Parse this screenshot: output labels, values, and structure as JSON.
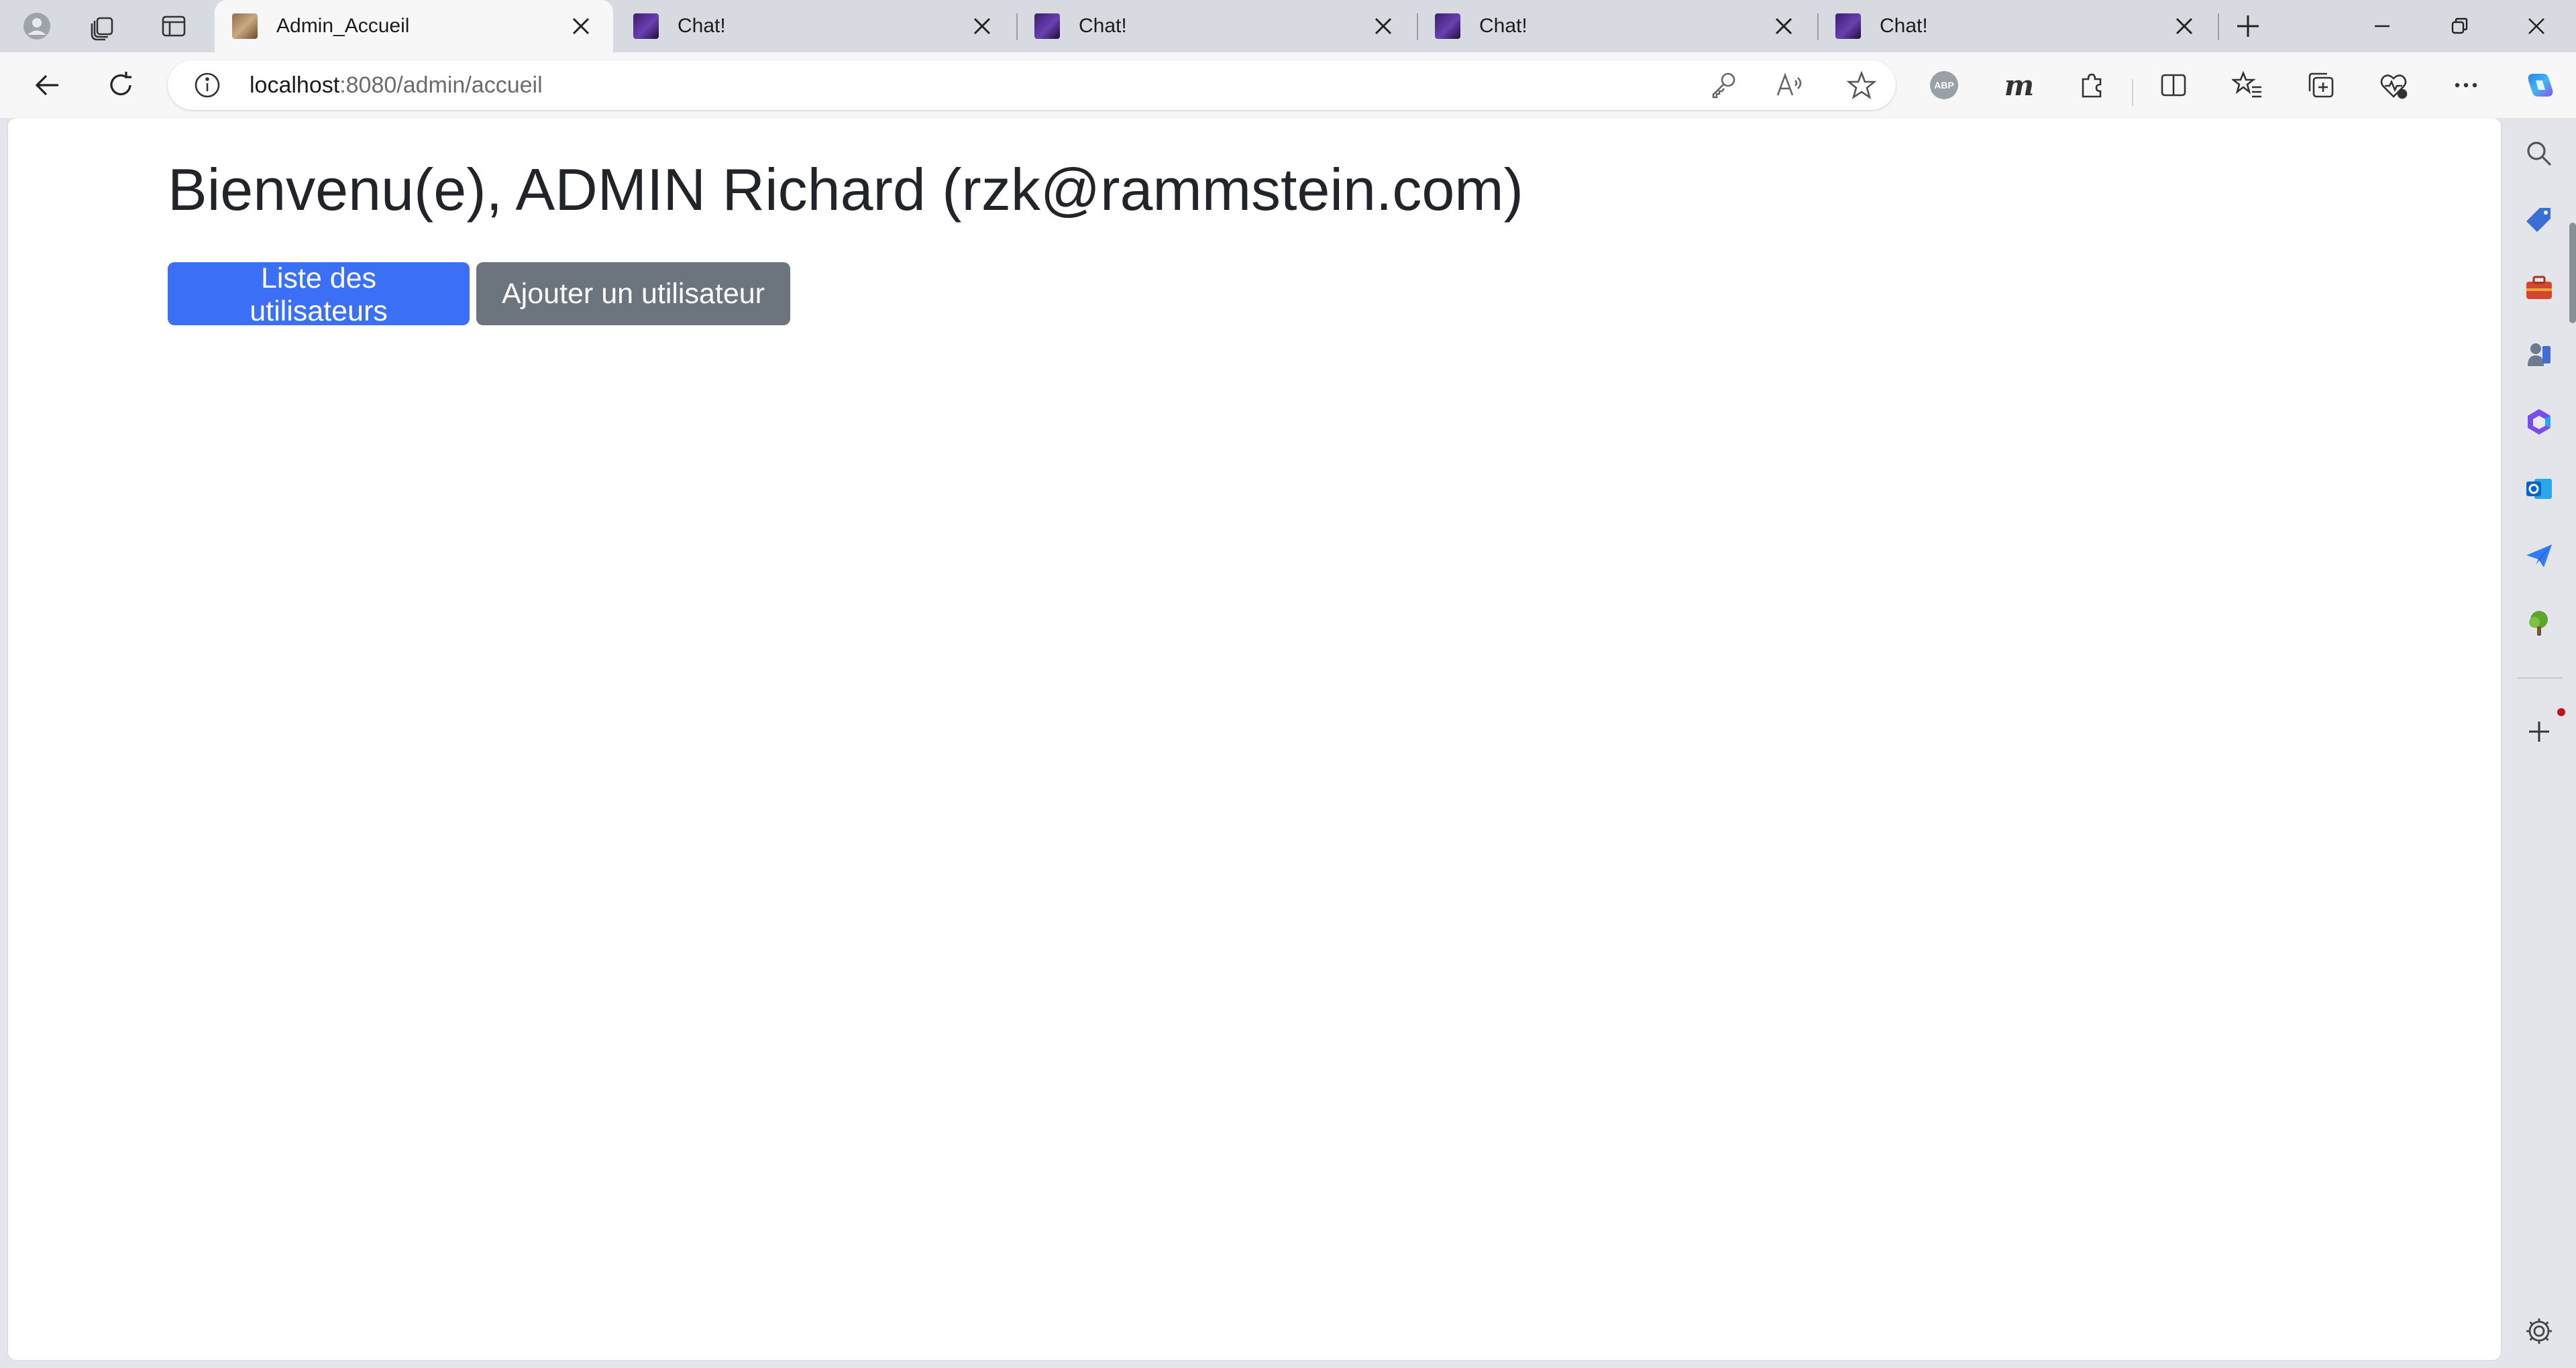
{
  "browser": {
    "tabs": [
      {
        "title": "Admin_Accueil",
        "active": true,
        "favicon": "admin-favicon"
      },
      {
        "title": "Chat!",
        "active": false,
        "favicon": "chat-favicon"
      },
      {
        "title": "Chat!",
        "active": false,
        "favicon": "chat-favicon"
      },
      {
        "title": "Chat!",
        "active": false,
        "favicon": "chat-favicon"
      },
      {
        "title": "Chat!",
        "active": false,
        "favicon": "chat-favicon"
      }
    ],
    "address": {
      "host": "localhost",
      "path": ":8080/admin/accueil"
    }
  },
  "page": {
    "heading": "Bienvenu(e), ADMIN Richard (rzk@rammstein.com)",
    "buttons": {
      "list_users": "Liste des utilisateurs",
      "add_user": "Ajouter un utilisateur"
    }
  },
  "colors": {
    "primary": "#3b6ff6",
    "secondary": "#6c757d",
    "heading": "#212529"
  }
}
